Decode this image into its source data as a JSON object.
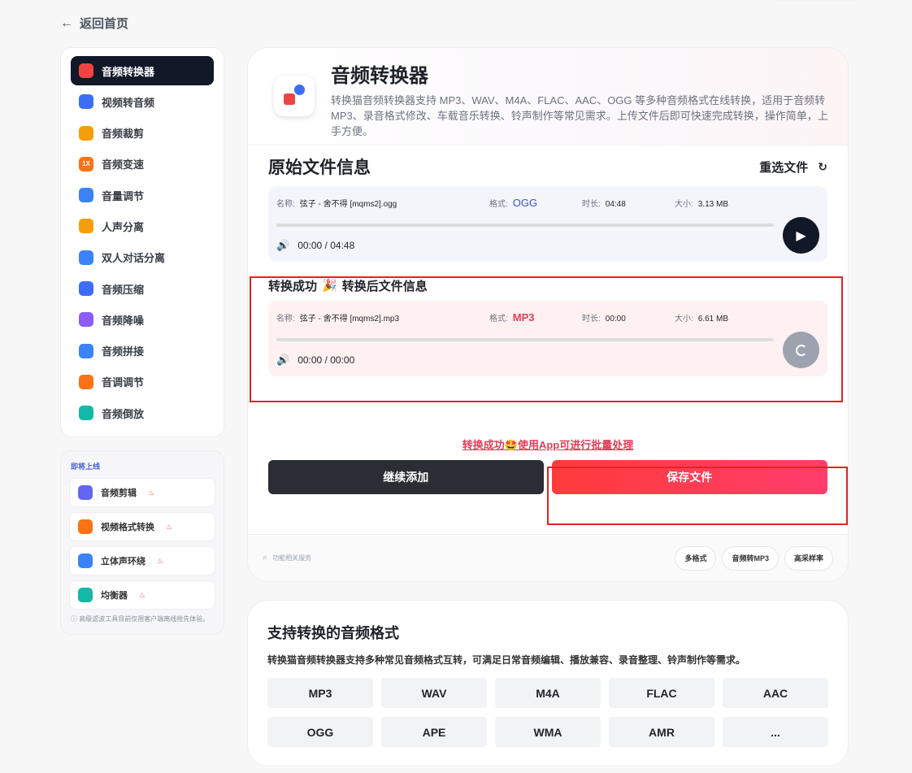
{
  "nav": {
    "back_label": "返回首页"
  },
  "sidebar": {
    "items": [
      {
        "label": "音频转换器",
        "icon": "audio-converter-icon",
        "color": "#ef4444"
      },
      {
        "label": "视频转音频",
        "icon": "video-to-audio-icon",
        "color": "#3b6ef5"
      },
      {
        "label": "音频裁剪",
        "icon": "audio-trim-icon",
        "color": "#f59e0b"
      },
      {
        "label": "音频变速",
        "icon": "speed-icon",
        "color": "#f97316",
        "glyph": "1X"
      },
      {
        "label": "音量调节",
        "icon": "volume-icon",
        "color": "#3b82f6"
      },
      {
        "label": "人声分离",
        "icon": "vocal-separate-icon",
        "color": "#f59e0b"
      },
      {
        "label": "双人对话分离",
        "icon": "dialog-separate-icon",
        "color": "#3b82f6"
      },
      {
        "label": "音频压缩",
        "icon": "compress-icon",
        "color": "#3b6ef5"
      },
      {
        "label": "音频降噪",
        "icon": "denoise-icon",
        "color": "#8b5cf6"
      },
      {
        "label": "音频拼接",
        "icon": "merge-icon",
        "color": "#3b82f6"
      },
      {
        "label": "音调调节",
        "icon": "pitch-icon",
        "color": "#f97316"
      },
      {
        "label": "音频倒放",
        "icon": "reverse-icon",
        "color": "#14b8a6"
      }
    ]
  },
  "coming": {
    "title": "即将上线",
    "items": [
      {
        "label": "音频剪辑",
        "icon": "scissors-icon",
        "color": "#6366f1"
      },
      {
        "label": "视频格式转换",
        "icon": "video-format-icon",
        "color": "#f97316"
      },
      {
        "label": "立体声环绕",
        "icon": "cube-icon",
        "color": "#3b82f6"
      },
      {
        "label": "均衡器",
        "icon": "equalizer-icon",
        "color": "#14b8a6"
      }
    ],
    "hot_glyph": "♨",
    "note": "ⓘ 高级滤波工具目前仅限客户端离线抢先体验。"
  },
  "hero": {
    "title": "音频转换器",
    "desc": "转换猫音频转换器支持 MP3、WAV、M4A、FLAC、AAC、OGG 等多种音频格式在线转换，适用于音频转 MP3、录音格式修改、车载音乐转换、铃声制作等常见需求。上传文件后即可快速完成转换，操作简单，上手方便。"
  },
  "original": {
    "title": "原始文件信息",
    "reselect": "重选文件",
    "name_label": "名称:",
    "name": "弦子 - 舍不得 [mqms2].ogg",
    "format_label": "格式:",
    "format": "OGG",
    "duration_label": "时长:",
    "duration": "04:48",
    "size_label": "大小:",
    "size": "3.13 MB",
    "time": "00:00 / 04:48"
  },
  "converted": {
    "title_prefix": "转换成功",
    "emoji": "🎉",
    "title_suffix": "转换后文件信息",
    "name_label": "名称:",
    "name": "弦子 - 舍不得 [mqms2].mp3",
    "format_label": "格式:",
    "format": "MP3",
    "duration_label": "时长:",
    "duration": "00:00",
    "size_label": "大小:",
    "size": "6.61 MB",
    "time": "00:00 / 00:00"
  },
  "batch_hint": "转换成功🤩使用App可进行批量处理",
  "buttons": {
    "continue": "继续添加",
    "save": "保存文件"
  },
  "footer": {
    "search_label": "功能相关服务",
    "chips": [
      "多格式",
      "音频转MP3",
      "高采样率"
    ]
  },
  "formats": {
    "title": "支持转换的音频格式",
    "desc": "转换猫音频转换器支持多种常见音频格式互转，可满足日常音频编辑、播放兼容、录音整理、铃声制作等需求。",
    "list": [
      "MP3",
      "WAV",
      "M4A",
      "FLAC",
      "AAC",
      "OGG",
      "APE",
      "WMA",
      "AMR",
      "..."
    ]
  }
}
